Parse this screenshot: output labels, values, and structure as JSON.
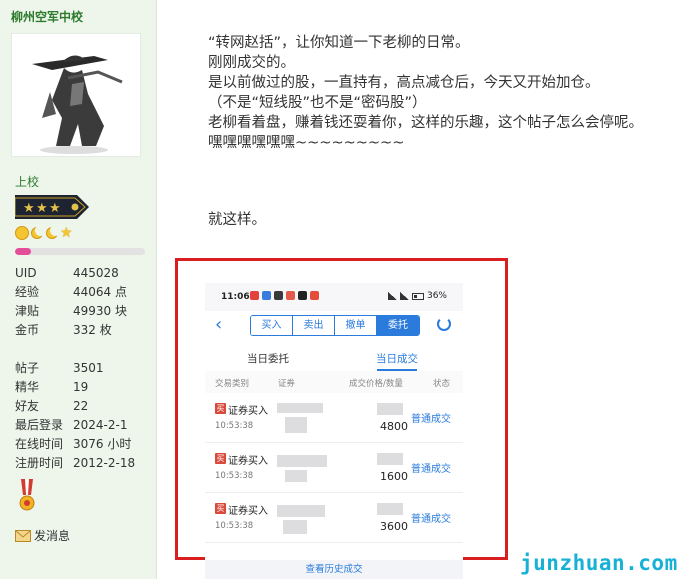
{
  "user": {
    "name": "柳州空军中校",
    "rank_title": "上校",
    "level_progress_pct": 12,
    "stats": [
      {
        "label": "UID",
        "value": "445028"
      },
      {
        "label": "经验",
        "value": "44064 点"
      },
      {
        "label": "津贴",
        "value": "49930 块"
      },
      {
        "label": "金币",
        "value": "332 枚"
      }
    ],
    "stats2": [
      {
        "label": "帖子",
        "value": "3501"
      },
      {
        "label": "精华",
        "value": "19"
      },
      {
        "label": "好友",
        "value": "22"
      },
      {
        "label": "最后登录",
        "value": "2024-2-1"
      },
      {
        "label": "在线时间",
        "value": "3076 小时"
      },
      {
        "label": "注册时间",
        "value": "2012-2-18"
      }
    ],
    "send_message": "发消息"
  },
  "post": {
    "lines": [
      "“转网赵括”，让你知道一下老柳的日常。",
      "刚刚成交的。",
      "是以前做过的股，一直持有，高点减仓后，今天又开始加仓。",
      "（不是“短线股”也不是“密码股”）",
      "老柳看着盘，赚着钱还耍着你，这样的乐趣，这个帖子怎么会停呢。",
      "嘿嘿嘿嘿嘿嘿~~~~~~~~~"
    ],
    "ending": "就这样。"
  },
  "screenshot": {
    "status_time": "11:06",
    "battery": "36%",
    "segments": [
      "买入",
      "卖出",
      "撤单",
      "委托"
    ],
    "tabs": {
      "left": "当日委托",
      "right": "当日成交"
    },
    "columns": [
      "交易类别",
      "证券",
      "成交价格/数量",
      "状态"
    ],
    "rows": [
      {
        "tag": "买",
        "type": "证券买入",
        "time": "10:53:38",
        "qty": "4800",
        "status": "普通成交"
      },
      {
        "tag": "买",
        "type": "证券买入",
        "time": "10:53:38",
        "qty": "1600",
        "status": "普通成交"
      },
      {
        "tag": "买",
        "type": "证券买入",
        "time": "10:53:38",
        "qty": "3600",
        "status": "普通成交"
      }
    ],
    "history_link": "查看历史成交"
  },
  "watermark": "junzhuan.com",
  "colors": {
    "sidebar_bg": "#eef6ec",
    "accent_green": "#2c7b2c",
    "frame_red": "#d81e1e",
    "app_blue": "#2a7bdc",
    "watermark": "#18b1d6"
  }
}
